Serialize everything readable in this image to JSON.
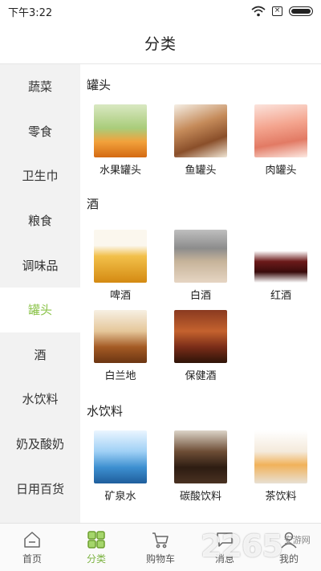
{
  "status_bar": {
    "time": "下午3:22"
  },
  "header": {
    "title": "分类"
  },
  "sidebar": {
    "items": [
      {
        "label": "蔬菜"
      },
      {
        "label": "零食"
      },
      {
        "label": "卫生巾"
      },
      {
        "label": "粮食"
      },
      {
        "label": "调味品"
      },
      {
        "label": "罐头",
        "active": true
      },
      {
        "label": "酒"
      },
      {
        "label": "水饮料"
      },
      {
        "label": "奶及酸奶"
      },
      {
        "label": "日用百货"
      }
    ]
  },
  "sections": [
    {
      "title": "罐头",
      "items": [
        {
          "label": "水果罐头",
          "icon": "fruit-can-image"
        },
        {
          "label": "鱼罐头",
          "icon": "fish-can-image"
        },
        {
          "label": "肉罐头",
          "icon": "meat-can-image"
        }
      ]
    },
    {
      "title": "酒",
      "items": [
        {
          "label": "啤酒",
          "icon": "beer-image"
        },
        {
          "label": "白酒",
          "icon": "baijiu-image"
        },
        {
          "label": "红酒",
          "icon": "red-wine-image"
        },
        {
          "label": "白兰地",
          "icon": "brandy-image"
        },
        {
          "label": "保健酒",
          "icon": "health-wine-image"
        }
      ]
    },
    {
      "title": "水饮料",
      "items": [
        {
          "label": "矿泉水",
          "icon": "mineral-water-image"
        },
        {
          "label": "碳酸饮料",
          "icon": "soda-image"
        },
        {
          "label": "茶饮料",
          "icon": "tea-drink-image"
        }
      ]
    }
  ],
  "bottom_nav": {
    "items": [
      {
        "label": "首页",
        "icon": "home-icon"
      },
      {
        "label": "分类",
        "icon": "category-icon",
        "active": true
      },
      {
        "label": "购物车",
        "icon": "cart-icon"
      },
      {
        "label": "消息",
        "icon": "message-icon"
      },
      {
        "label": "我的",
        "icon": "profile-icon"
      }
    ]
  },
  "watermark": {
    "text": "2265",
    "suffix": "安游网"
  },
  "colors": {
    "accent": "#8bc34a",
    "sidebar_bg": "#f2f2f2"
  }
}
